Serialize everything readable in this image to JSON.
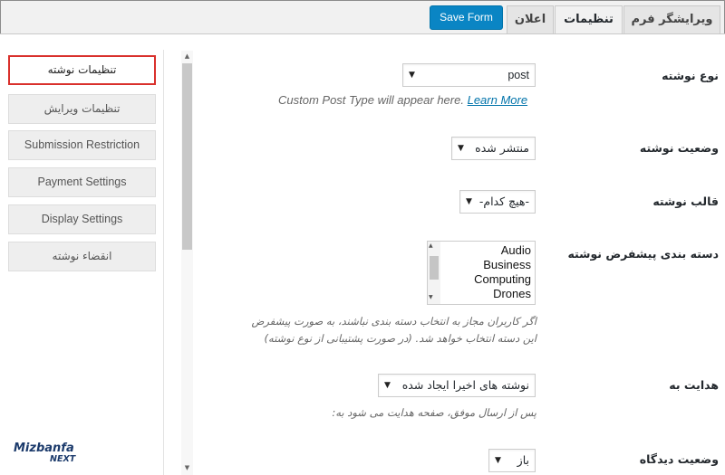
{
  "tabs": [
    {
      "label": "ویرایشگر فرم"
    },
    {
      "label": "تنظیمات"
    },
    {
      "label": "اعلان"
    }
  ],
  "toolbar": {
    "save_label": "Save Form"
  },
  "sidebar": {
    "items": [
      {
        "label": "تنظیمات نوشته"
      },
      {
        "label": "تنظیمات ویرایش"
      },
      {
        "label": "Submission Restriction"
      },
      {
        "label": "Payment Settings"
      },
      {
        "label": "Display Settings"
      },
      {
        "label": "انقضاء نوشته"
      }
    ]
  },
  "form": {
    "post_type": {
      "label": "نوع نوشته",
      "value": "post",
      "help_text": "Custom Post Type will appear here.",
      "help_link": "Learn More"
    },
    "post_status": {
      "label": "وضعیت نوشته",
      "value": "منتشر شده"
    },
    "post_template": {
      "label": "قالب نوشته",
      "value": "-هیچ کدام-"
    },
    "default_category": {
      "label": "دسته بندی پیشفرض نوشته",
      "options": [
        "Audio",
        "Business",
        "Computing",
        "Drones"
      ],
      "help_line1": "اگر کاربران مجاز به انتخاب دسته بندی نباشند، به صورت پیشفرض",
      "help_line2": "این دسته انتخاب خواهد شد. (در صورت پشتیبانی از نوع نوشته)"
    },
    "redirect_to": {
      "label": "هدایت به",
      "value": "نوشته های اخیرا ایجاد شده",
      "help_text": "پس از ارسال موفق، صفحه هدایت می شود به:"
    },
    "comment_status": {
      "label": "وضعیت دیدگاه",
      "value": "باز"
    }
  },
  "watermark": {
    "line1": "Mizbanfa",
    "line2": "NEXT"
  },
  "colors": {
    "accent": "#0a85c4",
    "highlight_border": "#d9302c",
    "link": "#0073aa"
  }
}
